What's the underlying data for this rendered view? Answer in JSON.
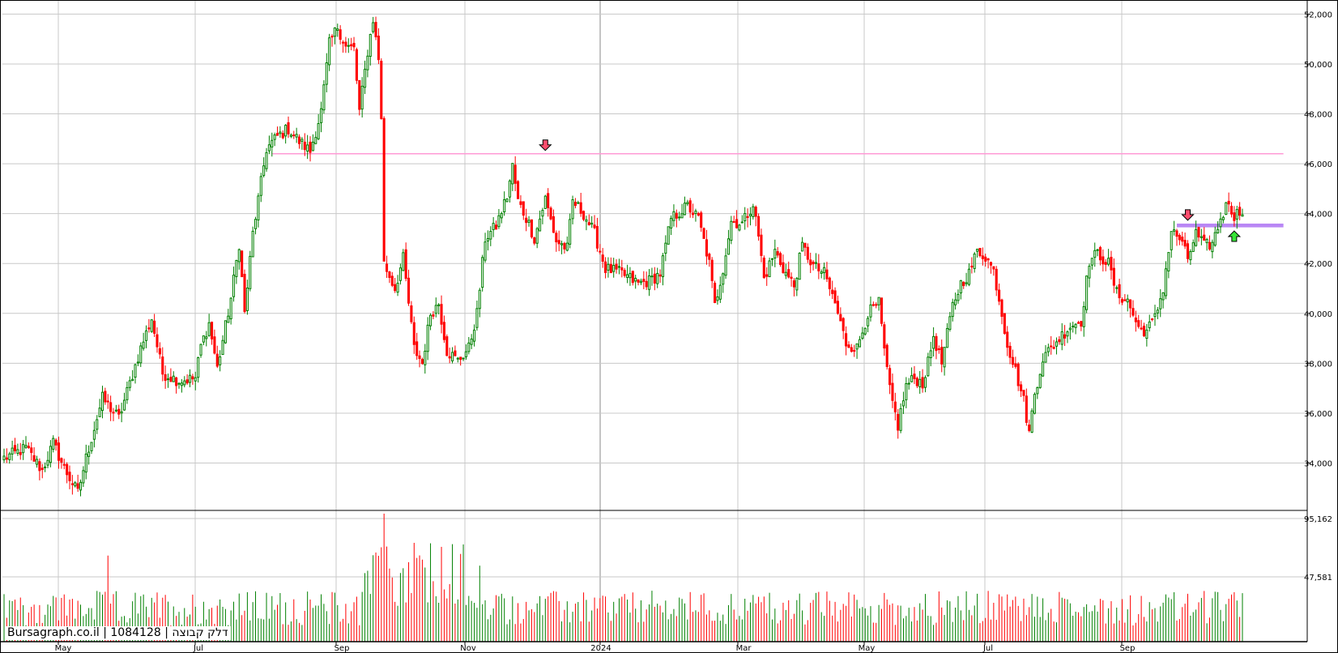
{
  "watermark": "Bursagraph.co.il | 1084128 | דלק קבוצה",
  "colors": {
    "up": "#008000",
    "down": "#ff0000",
    "grid": "#c8c8c8",
    "resistance": "#ff9ad6",
    "zone": "#b987f5",
    "arrow_down": "#ff4d6d",
    "arrow_up": "#37e637"
  },
  "chart_data": {
    "type": "candlestick",
    "x_labels": [
      "May",
      "Jul",
      "Sep",
      "Nov",
      "2024",
      "Mar",
      "May",
      "Jul",
      "Sep"
    ],
    "price_axis": {
      "ticks": [
        34000,
        36000,
        38000,
        40000,
        42000,
        44000,
        46000,
        48000,
        50000,
        52000
      ],
      "tick_labels": [
        "34,000",
        "36,000",
        "38,000",
        "40,000",
        "42,000",
        "44,000",
        "46,000",
        "48,000",
        "50,000",
        "52,000"
      ],
      "range": [
        32100,
        52500
      ]
    },
    "volume_axis": {
      "ticks": [
        47581,
        95162
      ],
      "tick_labels": [
        "47,581",
        "95,162"
      ],
      "max": 95162
    },
    "price_anchors": [
      {
        "t": 0,
        "v": 34200
      },
      {
        "t": 8,
        "v": 34600
      },
      {
        "t": 14,
        "v": 33700
      },
      {
        "t": 18,
        "v": 34800
      },
      {
        "t": 22,
        "v": 33800
      },
      {
        "t": 27,
        "v": 32800
      },
      {
        "t": 30,
        "v": 34200
      },
      {
        "t": 36,
        "v": 36600
      },
      {
        "t": 42,
        "v": 35800
      },
      {
        "t": 50,
        "v": 38600
      },
      {
        "t": 54,
        "v": 39800
      },
      {
        "t": 58,
        "v": 37600
      },
      {
        "t": 64,
        "v": 37300
      },
      {
        "t": 70,
        "v": 37400
      },
      {
        "t": 72,
        "v": 38700
      },
      {
        "t": 75,
        "v": 39600
      },
      {
        "t": 78,
        "v": 37800
      },
      {
        "t": 83,
        "v": 40600
      },
      {
        "t": 86,
        "v": 42800
      },
      {
        "t": 88,
        "v": 40000
      },
      {
        "t": 91,
        "v": 43200
      },
      {
        "t": 96,
        "v": 46600
      },
      {
        "t": 100,
        "v": 47100
      },
      {
        "t": 104,
        "v": 47400
      },
      {
        "t": 108,
        "v": 46900
      },
      {
        "t": 112,
        "v": 46500
      },
      {
        "t": 116,
        "v": 48100
      },
      {
        "t": 119,
        "v": 50800
      },
      {
        "t": 122,
        "v": 51500
      },
      {
        "t": 125,
        "v": 50700
      },
      {
        "t": 128,
        "v": 50600
      },
      {
        "t": 130,
        "v": 48100
      },
      {
        "t": 133,
        "v": 50500
      },
      {
        "t": 135,
        "v": 51800
      },
      {
        "t": 137,
        "v": 50200
      },
      {
        "t": 138,
        "v": 47900
      },
      {
        "t": 139,
        "v": 42000
      },
      {
        "t": 143,
        "v": 41000
      },
      {
        "t": 146,
        "v": 42200
      },
      {
        "t": 150,
        "v": 38600
      },
      {
        "t": 153,
        "v": 38000
      },
      {
        "t": 156,
        "v": 40000
      },
      {
        "t": 159,
        "v": 40400
      },
      {
        "t": 162,
        "v": 38500
      },
      {
        "t": 166,
        "v": 38100
      },
      {
        "t": 170,
        "v": 38600
      },
      {
        "t": 173,
        "v": 40000
      },
      {
        "t": 176,
        "v": 43000
      },
      {
        "t": 180,
        "v": 43500
      },
      {
        "t": 184,
        "v": 44700
      },
      {
        "t": 186,
        "v": 45900
      },
      {
        "t": 188,
        "v": 44500
      },
      {
        "t": 192,
        "v": 43600
      },
      {
        "t": 194,
        "v": 43000
      },
      {
        "t": 198,
        "v": 44600
      },
      {
        "t": 202,
        "v": 42900
      },
      {
        "t": 206,
        "v": 42600
      },
      {
        "t": 208,
        "v": 44500
      },
      {
        "t": 212,
        "v": 44000
      },
      {
        "t": 216,
        "v": 43200
      },
      {
        "t": 220,
        "v": 41800
      },
      {
        "t": 226,
        "v": 41600
      },
      {
        "t": 232,
        "v": 41200
      },
      {
        "t": 236,
        "v": 41300
      },
      {
        "t": 240,
        "v": 41600
      },
      {
        "t": 244,
        "v": 43800
      },
      {
        "t": 250,
        "v": 44300
      },
      {
        "t": 254,
        "v": 43800
      },
      {
        "t": 258,
        "v": 42000
      },
      {
        "t": 260,
        "v": 40300
      },
      {
        "t": 263,
        "v": 41800
      },
      {
        "t": 266,
        "v": 43700
      },
      {
        "t": 270,
        "v": 43600
      },
      {
        "t": 274,
        "v": 44400
      },
      {
        "t": 276,
        "v": 43100
      },
      {
        "t": 278,
        "v": 41400
      },
      {
        "t": 282,
        "v": 42500
      },
      {
        "t": 286,
        "v": 41600
      },
      {
        "t": 289,
        "v": 41100
      },
      {
        "t": 292,
        "v": 42700
      },
      {
        "t": 296,
        "v": 41900
      },
      {
        "t": 300,
        "v": 41600
      },
      {
        "t": 304,
        "v": 40400
      },
      {
        "t": 308,
        "v": 38800
      },
      {
        "t": 312,
        "v": 38600
      },
      {
        "t": 316,
        "v": 40000
      },
      {
        "t": 320,
        "v": 40400
      },
      {
        "t": 322,
        "v": 38500
      },
      {
        "t": 324,
        "v": 36900
      },
      {
        "t": 327,
        "v": 35500
      },
      {
        "t": 330,
        "v": 37100
      },
      {
        "t": 333,
        "v": 37400
      },
      {
        "t": 336,
        "v": 37200
      },
      {
        "t": 338,
        "v": 38000
      },
      {
        "t": 340,
        "v": 39100
      },
      {
        "t": 343,
        "v": 38000
      },
      {
        "t": 347,
        "v": 40300
      },
      {
        "t": 350,
        "v": 41200
      },
      {
        "t": 353,
        "v": 41600
      },
      {
        "t": 356,
        "v": 42500
      },
      {
        "t": 359,
        "v": 42300
      },
      {
        "t": 362,
        "v": 41700
      },
      {
        "t": 364,
        "v": 40600
      },
      {
        "t": 367,
        "v": 38800
      },
      {
        "t": 370,
        "v": 37700
      },
      {
        "t": 373,
        "v": 36500
      },
      {
        "t": 375,
        "v": 35200
      },
      {
        "t": 377,
        "v": 36800
      },
      {
        "t": 380,
        "v": 38200
      },
      {
        "t": 383,
        "v": 38600
      },
      {
        "t": 386,
        "v": 39000
      },
      {
        "t": 390,
        "v": 39500
      },
      {
        "t": 394,
        "v": 39700
      },
      {
        "t": 397,
        "v": 42100
      },
      {
        "t": 400,
        "v": 42400
      },
      {
        "t": 404,
        "v": 42000
      },
      {
        "t": 407,
        "v": 40800
      },
      {
        "t": 411,
        "v": 40500
      },
      {
        "t": 415,
        "v": 39400
      },
      {
        "t": 418,
        "v": 39300
      },
      {
        "t": 421,
        "v": 39800
      },
      {
        "t": 424,
        "v": 41000
      },
      {
        "t": 427,
        "v": 43300
      },
      {
        "t": 430,
        "v": 43000
      },
      {
        "t": 433,
        "v": 42200
      },
      {
        "t": 436,
        "v": 43200
      },
      {
        "t": 439,
        "v": 42700
      },
      {
        "t": 442,
        "v": 42800
      },
      {
        "t": 445,
        "v": 43800
      },
      {
        "t": 448,
        "v": 44500
      },
      {
        "t": 450,
        "v": 43900
      },
      {
        "t": 453,
        "v": 44200
      }
    ],
    "resistance_line": {
      "price": 46400,
      "from_t": 98,
      "to_t": 468
    },
    "support_zone": {
      "price_low": 43450,
      "price_high": 43600,
      "from_t": 429,
      "to_t": 468
    },
    "signals": [
      {
        "type": "sell",
        "t": 198,
        "price": 46500
      },
      {
        "type": "sell",
        "t": 433,
        "price": 43700
      },
      {
        "type": "buy",
        "t": 450,
        "price": 43500
      }
    ],
    "bars_count": 454
  }
}
